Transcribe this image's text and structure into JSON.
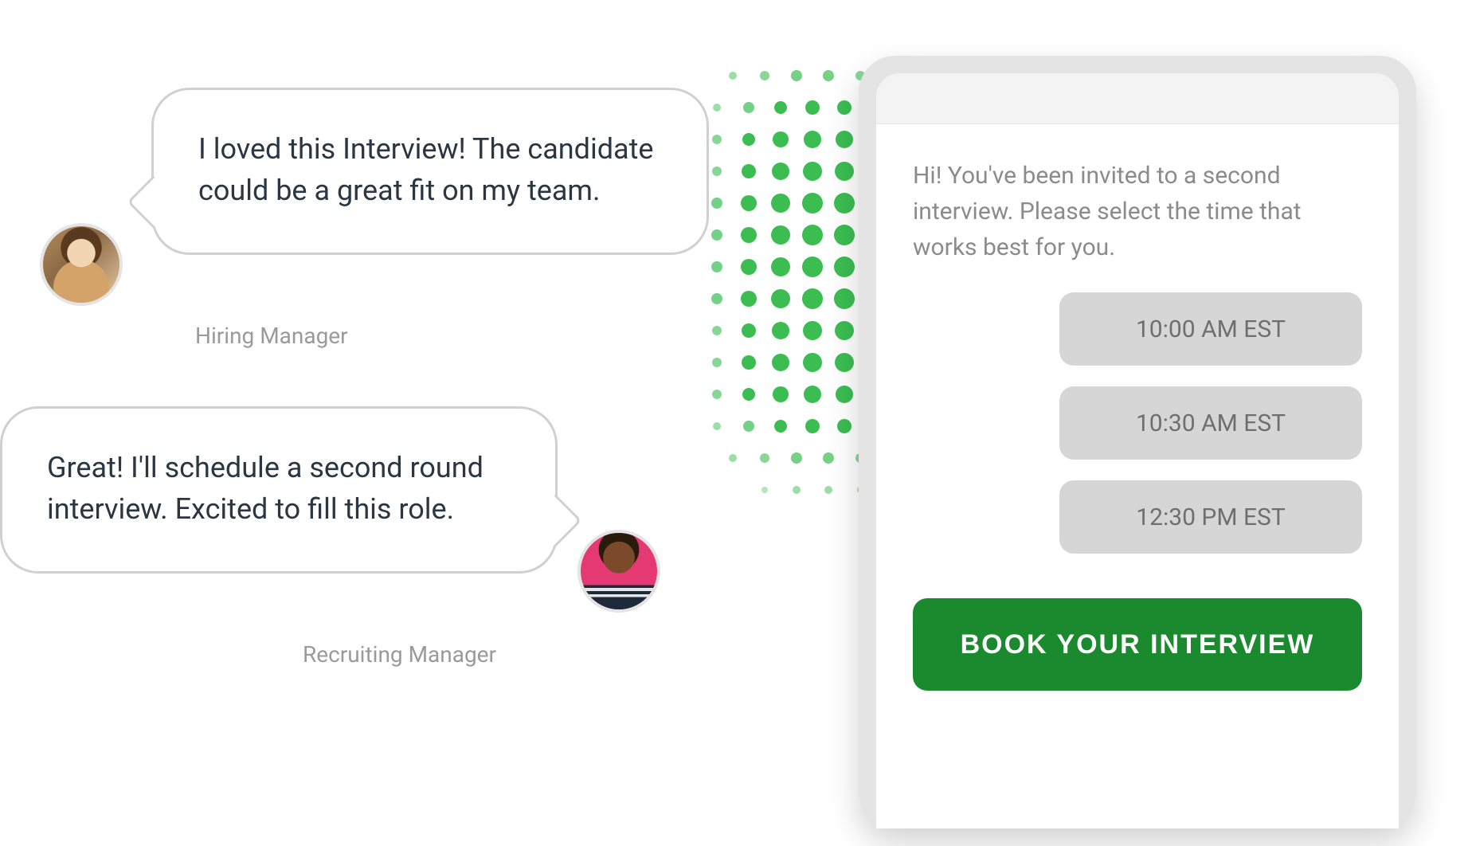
{
  "chat": {
    "message1": {
      "text": "I loved this Interview! The candidate could be a great fit on my team.",
      "role": "Hiring Manager"
    },
    "message2": {
      "text": "Great! I'll schedule a second round interview. Excited to fill this role.",
      "role": "Recruiting Manager"
    }
  },
  "booking": {
    "invite_text": "Hi! You've been invited to a second interview. Please select the time that works best for you.",
    "slots": [
      "10:00 AM EST",
      "10:30 AM EST",
      "12:30 PM EST"
    ],
    "button_label": "BOOK YOUR INTERVIEW"
  },
  "colors": {
    "accent_green": "#1b8a2f",
    "bubble_border": "#d0d0d0",
    "slot_bg": "#d6d6d6"
  }
}
